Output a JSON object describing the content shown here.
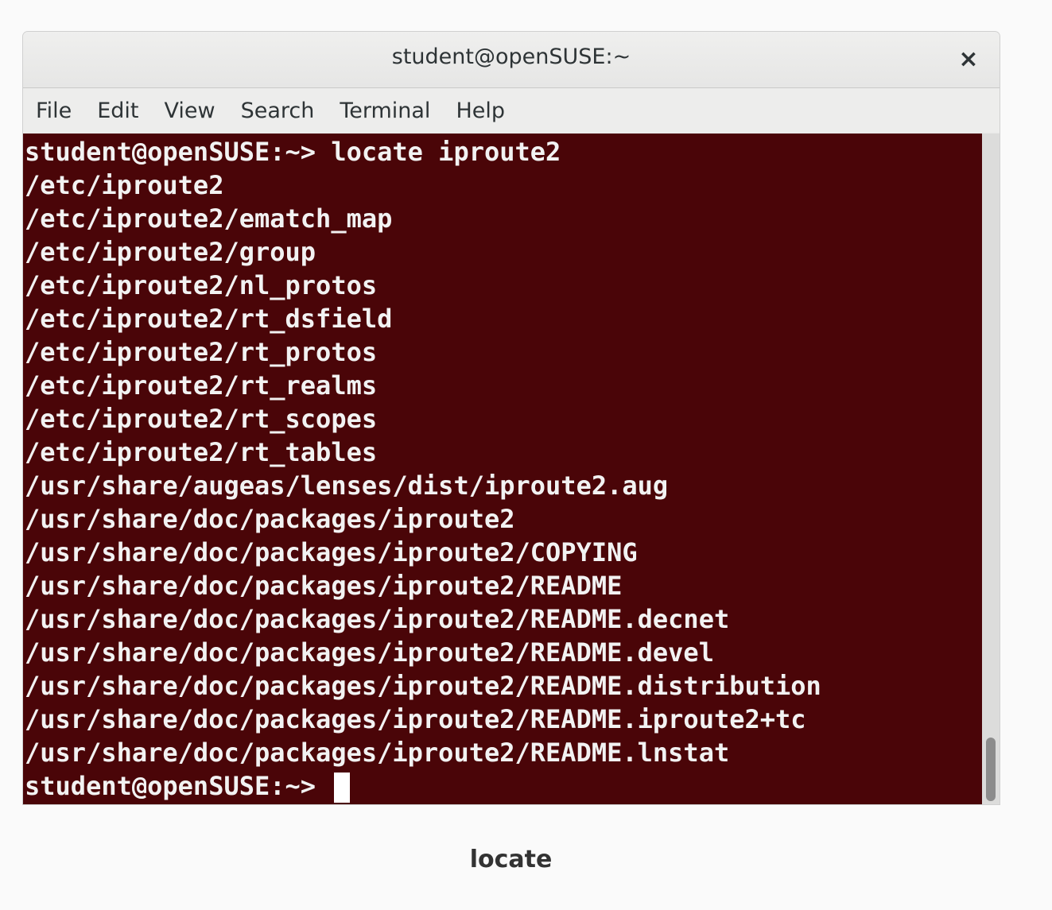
{
  "window": {
    "title": "student@openSUSE:~",
    "close_label": "×"
  },
  "menu": {
    "items": [
      "File",
      "Edit",
      "View",
      "Search",
      "Terminal",
      "Help"
    ]
  },
  "terminal": {
    "background_color": "#4a0508",
    "text_color": "#f2f2f2",
    "lines": [
      "student@openSUSE:~> locate iproute2",
      "/etc/iproute2",
      "/etc/iproute2/ematch_map",
      "/etc/iproute2/group",
      "/etc/iproute2/nl_protos",
      "/etc/iproute2/rt_dsfield",
      "/etc/iproute2/rt_protos",
      "/etc/iproute2/rt_realms",
      "/etc/iproute2/rt_scopes",
      "/etc/iproute2/rt_tables",
      "/usr/share/augeas/lenses/dist/iproute2.aug",
      "/usr/share/doc/packages/iproute2",
      "/usr/share/doc/packages/iproute2/COPYING",
      "/usr/share/doc/packages/iproute2/README",
      "/usr/share/doc/packages/iproute2/README.decnet",
      "/usr/share/doc/packages/iproute2/README.devel",
      "/usr/share/doc/packages/iproute2/README.distribution",
      "/usr/share/doc/packages/iproute2/README.iproute2+tc",
      "/usr/share/doc/packages/iproute2/README.lnstat"
    ],
    "prompt": "student@openSUSE:~> "
  },
  "caption": "locate"
}
